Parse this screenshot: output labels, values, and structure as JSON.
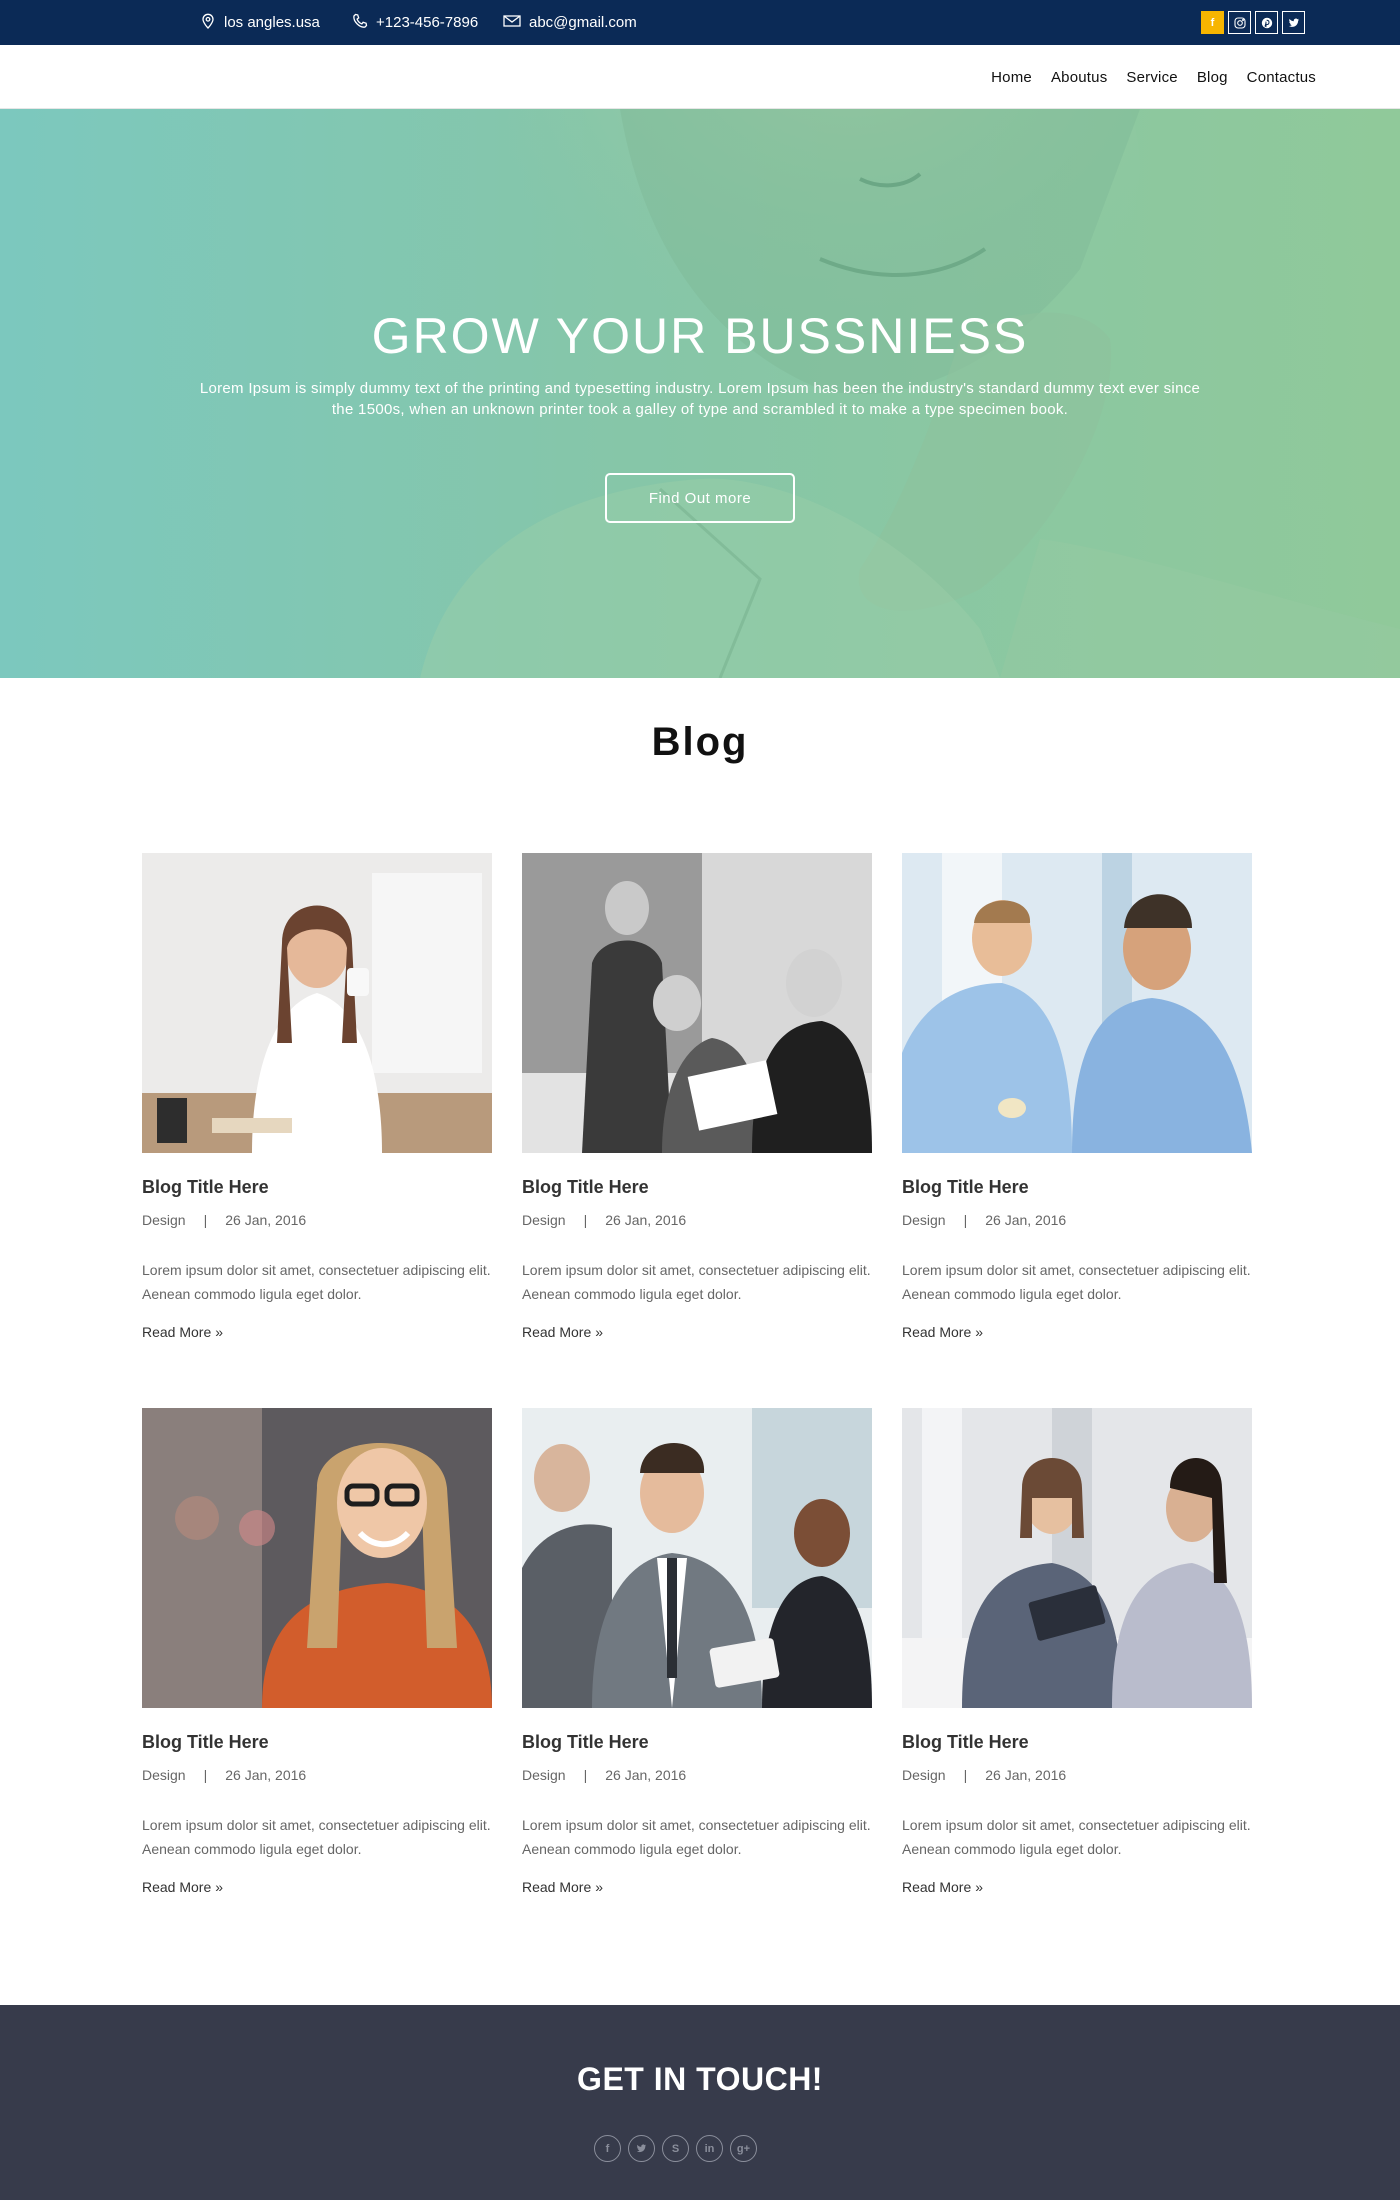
{
  "topbar": {
    "location": "los angles.usa",
    "phone": "+123-456-7896",
    "email": "abc@gmail.com",
    "social": [
      {
        "icon": "facebook-icon",
        "glyph": "f",
        "active": true
      },
      {
        "icon": "instagram-icon",
        "glyph": "",
        "active": false
      },
      {
        "icon": "pinterest-icon",
        "glyph": "",
        "active": false
      },
      {
        "icon": "twitter-icon",
        "glyph": "",
        "active": false
      }
    ],
    "bg_color": "#0b2a56",
    "accent_color": "#f7b500"
  },
  "nav": {
    "items": [
      "Home",
      "Aboutus",
      "Service",
      "Blog",
      "Contactus"
    ]
  },
  "hero": {
    "title": "GROW YOUR BUSSNIESS",
    "text": "Lorem Ipsum is simply dummy text of the printing and typesetting industry. Lorem Ipsum has been the industry's standard dummy text ever since the 1500s, when an unknown printer took a galley of type and scrambled it to make a type specimen book.",
    "button": "Find Out more"
  },
  "blog": {
    "heading": "Blog",
    "posts": [
      {
        "title": "Blog Title Here",
        "category": "Design",
        "separator": "|",
        "date": "26 Jan, 2016",
        "excerpt": "Lorem ipsum dolor sit amet, consectetuer adipiscing elit. Aenean commodo ligula eget dolor.",
        "more": "Read More",
        "more_icon": "double-chevron-right-icon"
      },
      {
        "title": "Blog Title Here",
        "category": "Design",
        "separator": "|",
        "date": "26 Jan, 2016",
        "excerpt": "Lorem ipsum dolor sit amet, consectetuer adipiscing elit. Aenean commodo ligula eget dolor.",
        "more": "Read More",
        "more_icon": "double-chevron-right-icon"
      },
      {
        "title": "Blog Title Here",
        "category": "Design",
        "separator": "|",
        "date": "26 Jan, 2016",
        "excerpt": "Lorem ipsum dolor sit amet, consectetuer adipiscing elit. Aenean commodo ligula eget dolor.",
        "more": "Read More",
        "more_icon": "double-chevron-right-icon"
      },
      {
        "title": "Blog Title Here",
        "category": "Design",
        "separator": "|",
        "date": "26 Jan, 2016",
        "excerpt": "Lorem ipsum dolor sit amet, consectetuer adipiscing elit. Aenean commodo ligula eget dolor.",
        "more": "Read More",
        "more_icon": "double-chevron-right-icon"
      },
      {
        "title": "Blog Title Here",
        "category": "Design",
        "separator": "|",
        "date": "26 Jan, 2016",
        "excerpt": "Lorem ipsum dolor sit amet, consectetuer adipiscing elit. Aenean commodo ligula eget dolor.",
        "more": "Read More",
        "more_icon": "double-chevron-right-icon"
      },
      {
        "title": "Blog Title Here",
        "category": "Design",
        "separator": "|",
        "date": "26 Jan, 2016",
        "excerpt": "Lorem ipsum dolor sit amet, consectetuer adipiscing elit. Aenean commodo ligula eget dolor.",
        "more": "Read More",
        "more_icon": "double-chevron-right-icon"
      }
    ]
  },
  "footer": {
    "title": "GET IN TOUCH!",
    "social": [
      {
        "icon": "facebook-icon",
        "glyph": "f"
      },
      {
        "icon": "twitter-icon",
        "glyph": ""
      },
      {
        "icon": "skype-icon",
        "glyph": "S"
      },
      {
        "icon": "linkedin-icon",
        "glyph": "in"
      },
      {
        "icon": "google-plus-icon",
        "glyph": "g+"
      }
    ],
    "bg_color": "#373b4b"
  }
}
